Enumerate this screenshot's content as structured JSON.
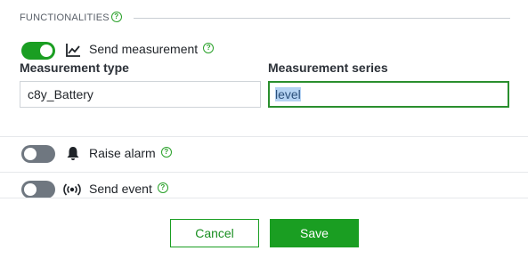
{
  "section": {
    "title": "FUNCTIONALITIES"
  },
  "functions": {
    "send_measurement": {
      "label": "Send measurement",
      "enabled": true
    },
    "raise_alarm": {
      "label": "Raise alarm",
      "enabled": false
    },
    "send_event": {
      "label": "Send event",
      "enabled": false
    }
  },
  "measurement_form": {
    "type_label": "Measurement type",
    "type_value": "c8y_Battery",
    "series_label": "Measurement series",
    "series_value": "level"
  },
  "actions": {
    "cancel_label": "Cancel",
    "save_label": "Save"
  },
  "icons": {
    "help": "help-circle-icon",
    "measurement": "line-chart-icon",
    "alarm": "bell-icon",
    "event": "broadcast-icon"
  },
  "colors": {
    "accent": "#1a9e22",
    "toggle_off": "#6f7780",
    "focus_border": "#2a8f2e"
  }
}
